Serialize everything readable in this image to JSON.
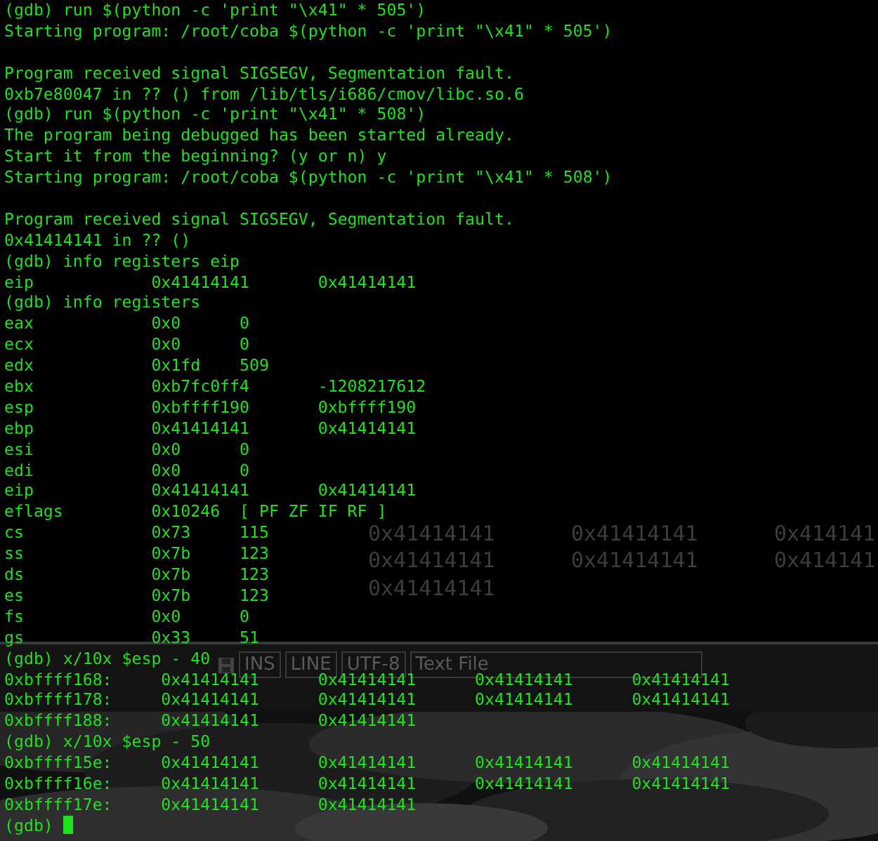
{
  "background_window": {
    "lines": [
      {
        "kind": "memory",
        "values": [
          "0x41414141",
          "0x41414141",
          "0x414141"
        ]
      },
      {
        "kind": "memory",
        "values": [
          "0x41414141",
          "0x41414141",
          "0x414141"
        ]
      },
      {
        "kind": "memory",
        "values": [
          "0x41414141"
        ]
      }
    ]
  },
  "status_bar": {
    "items": [
      "INS",
      "LINE",
      "UTF-8",
      "Text File"
    ]
  },
  "terminal": {
    "lines": [
      {
        "kind": "text",
        "text": "(gdb) run $(python -c 'print \"\\x41\" * 505')"
      },
      {
        "kind": "text",
        "text": "Starting program: /root/coba $(python -c 'print \"\\x41\" * 505')"
      },
      {
        "kind": "blank"
      },
      {
        "kind": "text",
        "text": "Program received signal SIGSEGV, Segmentation fault."
      },
      {
        "kind": "text",
        "text": "0xb7e80047 in ?? () from /lib/tls/i686/cmov/libc.so.6"
      },
      {
        "kind": "text",
        "text": "(gdb) run $(python -c 'print \"\\x41\" * 508')"
      },
      {
        "kind": "text",
        "text": "The program being debugged has been started already."
      },
      {
        "kind": "text",
        "text": "Start it from the beginning? (y or n) y"
      },
      {
        "kind": "text",
        "text": "Starting program: /root/coba $(python -c 'print \"\\x41\" * 508')"
      },
      {
        "kind": "blank"
      },
      {
        "kind": "text",
        "text": "Program received signal SIGSEGV, Segmentation fault."
      },
      {
        "kind": "text",
        "text": "0x41414141 in ?? ()"
      },
      {
        "kind": "text",
        "text": "(gdb) info registers eip"
      },
      {
        "kind": "register",
        "name": "eip",
        "hex": "0x41414141",
        "natural": "0x41414141"
      },
      {
        "kind": "text",
        "text": "(gdb) info registers"
      },
      {
        "kind": "register",
        "name": "eax",
        "hex": "0x0",
        "natural": "0"
      },
      {
        "kind": "register",
        "name": "ecx",
        "hex": "0x0",
        "natural": "0"
      },
      {
        "kind": "register",
        "name": "edx",
        "hex": "0x1fd",
        "natural": "509"
      },
      {
        "kind": "register",
        "name": "ebx",
        "hex": "0xb7fc0ff4",
        "natural": "-1208217612"
      },
      {
        "kind": "register",
        "name": "esp",
        "hex": "0xbffff190",
        "natural": "0xbffff190"
      },
      {
        "kind": "register",
        "name": "ebp",
        "hex": "0x41414141",
        "natural": "0x41414141"
      },
      {
        "kind": "register",
        "name": "esi",
        "hex": "0x0",
        "natural": "0"
      },
      {
        "kind": "register",
        "name": "edi",
        "hex": "0x0",
        "natural": "0"
      },
      {
        "kind": "register",
        "name": "eip",
        "hex": "0x41414141",
        "natural": "0x41414141"
      },
      {
        "kind": "register",
        "name": "eflags",
        "hex": "0x10246",
        "natural": "[ PF ZF IF RF ]"
      },
      {
        "kind": "register",
        "name": "cs",
        "hex": "0x73",
        "natural": "115"
      },
      {
        "kind": "register",
        "name": "ss",
        "hex": "0x7b",
        "natural": "123"
      },
      {
        "kind": "register",
        "name": "ds",
        "hex": "0x7b",
        "natural": "123"
      },
      {
        "kind": "register",
        "name": "es",
        "hex": "0x7b",
        "natural": "123"
      },
      {
        "kind": "register",
        "name": "fs",
        "hex": "0x0",
        "natural": "0"
      },
      {
        "kind": "register",
        "name": "gs",
        "hex": "0x33",
        "natural": "51"
      },
      {
        "kind": "text",
        "text": "(gdb) x/10x $esp - 40"
      },
      {
        "kind": "memory",
        "address": "0xbffff168:",
        "values": [
          "0x41414141",
          "0x41414141",
          "0x41414141",
          "0x41414141"
        ]
      },
      {
        "kind": "memory",
        "address": "0xbffff178:",
        "values": [
          "0x41414141",
          "0x41414141",
          "0x41414141",
          "0x41414141"
        ]
      },
      {
        "kind": "memory",
        "address": "0xbffff188:",
        "values": [
          "0x41414141",
          "0x41414141"
        ]
      },
      {
        "kind": "text",
        "text": "(gdb) x/10x $esp - 50"
      },
      {
        "kind": "memory",
        "address": "0xbffff15e:",
        "values": [
          "0x41414141",
          "0x41414141",
          "0x41414141",
          "0x41414141"
        ]
      },
      {
        "kind": "memory",
        "address": "0xbffff16e:",
        "values": [
          "0x41414141",
          "0x41414141",
          "0x41414141",
          "0x41414141"
        ]
      },
      {
        "kind": "memory",
        "address": "0xbffff17e:",
        "values": [
          "0x41414141",
          "0x41414141"
        ]
      },
      {
        "kind": "prompt",
        "text": "(gdb)",
        "cursor": true
      }
    ]
  }
}
